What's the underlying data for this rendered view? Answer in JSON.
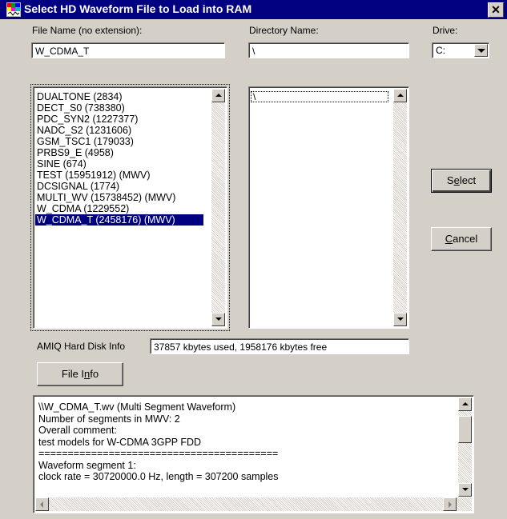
{
  "window": {
    "title": "Select HD Waveform File to Load into RAM",
    "close_label": "✕"
  },
  "file_name": {
    "label": "File Name (no extension):",
    "value": "W_CDMA_T"
  },
  "directory": {
    "label": "Directory Name:",
    "value": "\\"
  },
  "drive": {
    "label": "Drive:",
    "value": "C:"
  },
  "file_list": {
    "items": [
      "DUALTONE (2834)",
      "DECT_S0 (738380)",
      "PDC_SYN2 (1227377)",
      "NADC_S2 (1231606)",
      "GSM_TSC1 (179033)",
      "PRBS9_E (4958)",
      "SINE (674)",
      "TEST (15951912) (MWV)",
      "DCSIGNAL (1774)",
      "MULTI_WV (15738452) (MWV)",
      "W_CDMA (1229552)",
      "W_CDMA_T (2458176) (MWV)"
    ],
    "selected_index": 11
  },
  "dir_list": {
    "items": [
      "\\"
    ]
  },
  "buttons": {
    "select_pre": "S",
    "select_ul": "e",
    "select_post": "lect",
    "cancel_pre": "",
    "cancel_ul": "C",
    "cancel_post": "ancel",
    "fileinfo_pre": "File I",
    "fileinfo_ul": "n",
    "fileinfo_post": "fo"
  },
  "disk_info": {
    "label": "AMIQ Hard Disk Info",
    "value": "37857 kbytes used, 1958176 kbytes free"
  },
  "info_text": {
    "lines": [
      "\\\\W_CDMA_T.wv (Multi Segment Waveform)",
      "Number of segments in MWV: 2",
      "Overall comment:",
      "test models for W-CDMA 3GPP FDD",
      "=========================================",
      "Waveform segment 1:",
      "clock rate =  30720000.0 Hz, length =  307200 samples"
    ]
  },
  "colors": {
    "titlebar": "#000080",
    "dialog_bg": "#d4d0c8",
    "selection": "#000080"
  }
}
